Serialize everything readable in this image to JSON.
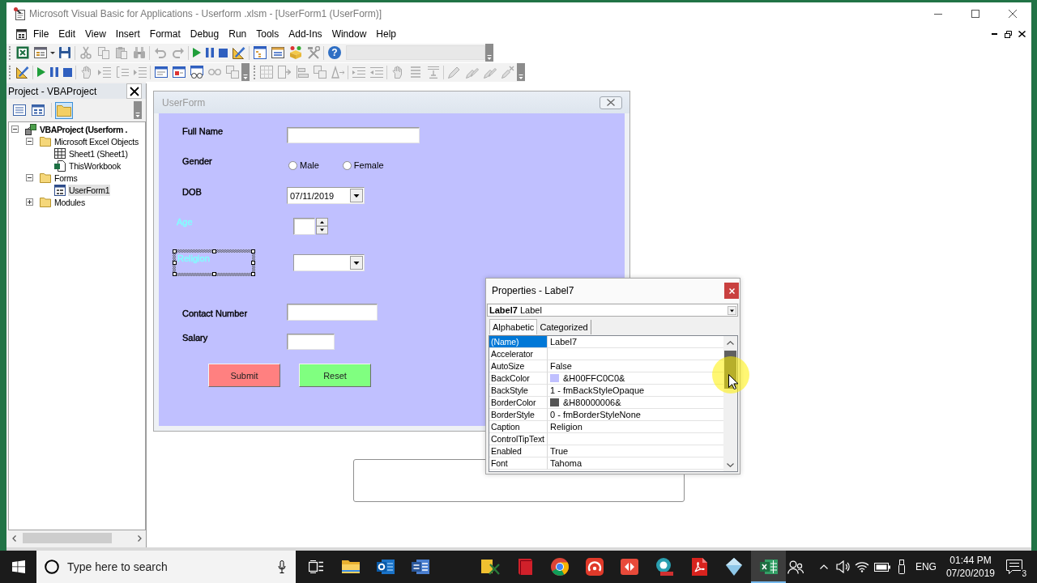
{
  "window": {
    "title": "Microsoft Visual Basic for Applications - Userform .xlsm - [UserForm1 (UserForm)]"
  },
  "menu": [
    "File",
    "Edit",
    "View",
    "Insert",
    "Format",
    "Debug",
    "Run",
    "Tools",
    "Add-Ins",
    "Window",
    "Help"
  ],
  "toolbar": {
    "help": "?"
  },
  "project": {
    "title": "Project - VBAProject",
    "folders_toggle": {
      "on": true
    },
    "tree": [
      {
        "label": "VBAProject (Userform .",
        "kind": "project",
        "expanded": true,
        "selected": false,
        "children": [
          {
            "label": "Microsoft Excel Objects",
            "kind": "folder",
            "expanded": true,
            "selected": false,
            "children": [
              {
                "label": "Sheet1 (Sheet1)",
                "kind": "sheet",
                "selected": false
              },
              {
                "label": "ThisWorkbook",
                "kind": "workbook",
                "selected": false
              }
            ]
          },
          {
            "label": "Forms",
            "kind": "folder",
            "expanded": true,
            "selected": false,
            "children": [
              {
                "label": "UserForm1",
                "kind": "form",
                "selected": true
              }
            ]
          },
          {
            "label": "Modules",
            "kind": "folder",
            "expanded": false,
            "selected": false
          }
        ]
      }
    ]
  },
  "designer": {
    "title": "UserForm",
    "rows": [
      {
        "label": "Full Name",
        "color": "#000000",
        "selected": false,
        "control": {
          "kind": "textbox"
        }
      },
      {
        "label": "Gender",
        "color": "#000000",
        "selected": false,
        "control": {
          "kind": "options",
          "options": [
            {
              "label": "Male",
              "selected": false
            },
            {
              "label": "Female",
              "selected": false
            }
          ]
        }
      },
      {
        "label": "DOB",
        "color": "#000000",
        "selected": false,
        "control": {
          "kind": "combobox",
          "value": "07/11/2019"
        }
      },
      {
        "label": "Age",
        "color": "#80ffff",
        "selected": false,
        "control": {
          "kind": "spin"
        }
      },
      {
        "label": "Religion",
        "color": "#80ffff",
        "selected": true,
        "control": {
          "kind": "combobox"
        }
      },
      {
        "label": "Contact Number",
        "color": "#000000",
        "selected": false,
        "control": {
          "kind": "textbox"
        }
      },
      {
        "label": "Salary",
        "color": "#000000",
        "selected": false,
        "control": {
          "kind": "textbox"
        }
      }
    ],
    "buttons": [
      {
        "label": "Submit",
        "color": "#ff8080"
      },
      {
        "label": "Reset",
        "color": "#80ff80"
      }
    ]
  },
  "properties": {
    "title": "Properties - Label7",
    "object": "**Label7** Label",
    "tabs": [
      {
        "label": "Alphabetic",
        "selected": true
      },
      {
        "label": "Categorized",
        "selected": false
      }
    ],
    "rows": [
      {
        "name": "(Name)",
        "value": "Label7",
        "selected": true
      },
      {
        "name": "Accelerator",
        "selected": false
      },
      {
        "name": "AutoSize",
        "value": "False",
        "selected": false
      },
      {
        "name": "BackColor",
        "value": "&H00FFC0C0&",
        "color": "#c0c0ff",
        "selected": false
      },
      {
        "name": "BackStyle",
        "value": "1 - fmBackStyleOpaque",
        "selected": false
      },
      {
        "name": "BorderColor",
        "value": "&H80000006&",
        "color": "#555555",
        "selected": false
      },
      {
        "name": "BorderStyle",
        "value": "0 - fmBorderStyleNone",
        "selected": false
      },
      {
        "name": "Caption",
        "value": "Religion",
        "selected": false
      },
      {
        "name": "ControlTipText",
        "selected": false
      },
      {
        "name": "Enabled",
        "value": "True",
        "selected": false
      },
      {
        "name": "Font",
        "value": "Tahoma",
        "selected": false
      }
    ]
  },
  "taskbar": {
    "search": {
      "placeholder": "Type here to search"
    },
    "apps": [
      {
        "selected": false
      },
      {
        "selected": false
      },
      {
        "selected": false
      },
      {
        "selected": false
      },
      {
        "selected": false
      },
      {
        "selected": false
      },
      {
        "selected": false
      },
      {
        "selected": false
      },
      {
        "selected": false
      },
      {
        "selected": false
      },
      {
        "selected": false
      },
      {
        "selected": true
      }
    ],
    "language": "ENG",
    "time": "01:44 PM",
    "date": "07/20/2019",
    "notifications": "3"
  }
}
